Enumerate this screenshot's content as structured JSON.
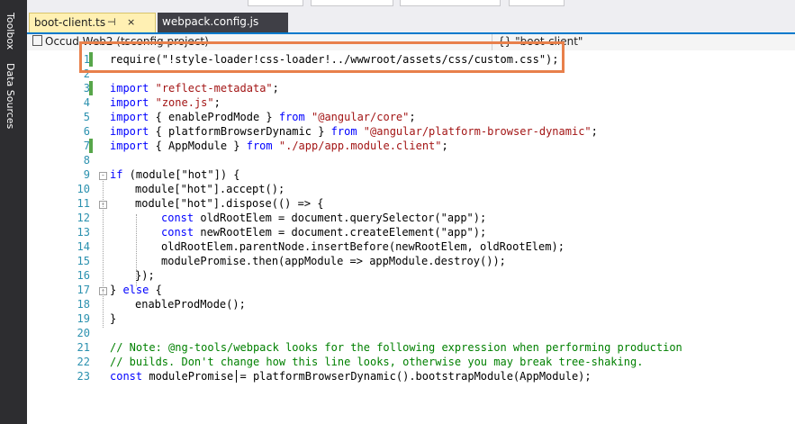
{
  "side_panel": {
    "toolbox_label": "Toolbox",
    "data_sources_label": "Data Sources"
  },
  "tabs": [
    {
      "label": "boot-client.ts",
      "active": true,
      "pin_icon": "⊣",
      "close_icon": "×"
    },
    {
      "label": "webpack.config.js",
      "active": false
    }
  ],
  "nav_bar": {
    "project": "Occud.Web2 (tsconfig project)",
    "scope": "{} \"boot-client\""
  },
  "colors": {
    "keyword": "#0000ff",
    "string": "#a31515",
    "comment": "#008000",
    "line_number": "#2b91af",
    "highlight_box": "#e8804b",
    "changed_line_marker": "#57a64a"
  },
  "code": {
    "l1": {
      "num": "1",
      "text": "require(\"!style-loader!css-loader!../wwwroot/assets/css/custom.css\");"
    },
    "l2": {
      "num": "2"
    },
    "l3": {
      "num": "3",
      "kw": "import",
      "str": "\"reflect-metadata\"",
      "post": ";"
    },
    "l4": {
      "num": "4",
      "kw": "import",
      "str": "\"zone.js\"",
      "post": ";"
    },
    "l5": {
      "num": "5",
      "kw": "import",
      "mid": " { enableProdMode } ",
      "kw2": "from",
      "str": "\"@angular/core\"",
      "post": ";"
    },
    "l6": {
      "num": "6",
      "kw": "import",
      "mid": " { platformBrowserDynamic } ",
      "kw2": "from",
      "str": "\"@angular/platform-browser-dynamic\"",
      "post": ";"
    },
    "l7": {
      "num": "7",
      "kw": "import",
      "mid": " { AppModule } ",
      "kw2": "from",
      "str": "\"./app/app.module.client\"",
      "post": ";"
    },
    "l8": {
      "num": "8"
    },
    "l9": {
      "num": "9",
      "kw": "if",
      "text": " (module[\"hot\"]) {"
    },
    "l10": {
      "num": "10",
      "text": "module[\"hot\"].accept();"
    },
    "l11": {
      "num": "11",
      "text": "module[\"hot\"].dispose(() => {"
    },
    "l12": {
      "num": "12",
      "kw": "const",
      "text": " oldRootElem = document.querySelector(\"app\");"
    },
    "l13": {
      "num": "13",
      "kw": "const",
      "text": " newRootElem = document.createElement(\"app\");"
    },
    "l14": {
      "num": "14",
      "text": "oldRootElem.parentNode.insertBefore(newRootElem, oldRootElem);"
    },
    "l15": {
      "num": "15",
      "text": "modulePromise.then(appModule => appModule.destroy());"
    },
    "l16": {
      "num": "16",
      "text": "});"
    },
    "l17": {
      "num": "17",
      "pre": "} ",
      "kw": "else",
      "post": " {"
    },
    "l18": {
      "num": "18",
      "text": "enableProdMode();"
    },
    "l19": {
      "num": "19",
      "text": "}"
    },
    "l20": {
      "num": "20"
    },
    "l21": {
      "num": "21",
      "text": "// Note: @ng-tools/webpack looks for the following expression when performing production"
    },
    "l22": {
      "num": "22",
      "text": "// builds. Don't change how this line looks, otherwise you may break tree-shaking."
    },
    "l23": {
      "num": "23",
      "kw": "const",
      "text": " modulePromise = platformBrowserDynamic().bootstrapModule(AppModule);"
    }
  }
}
